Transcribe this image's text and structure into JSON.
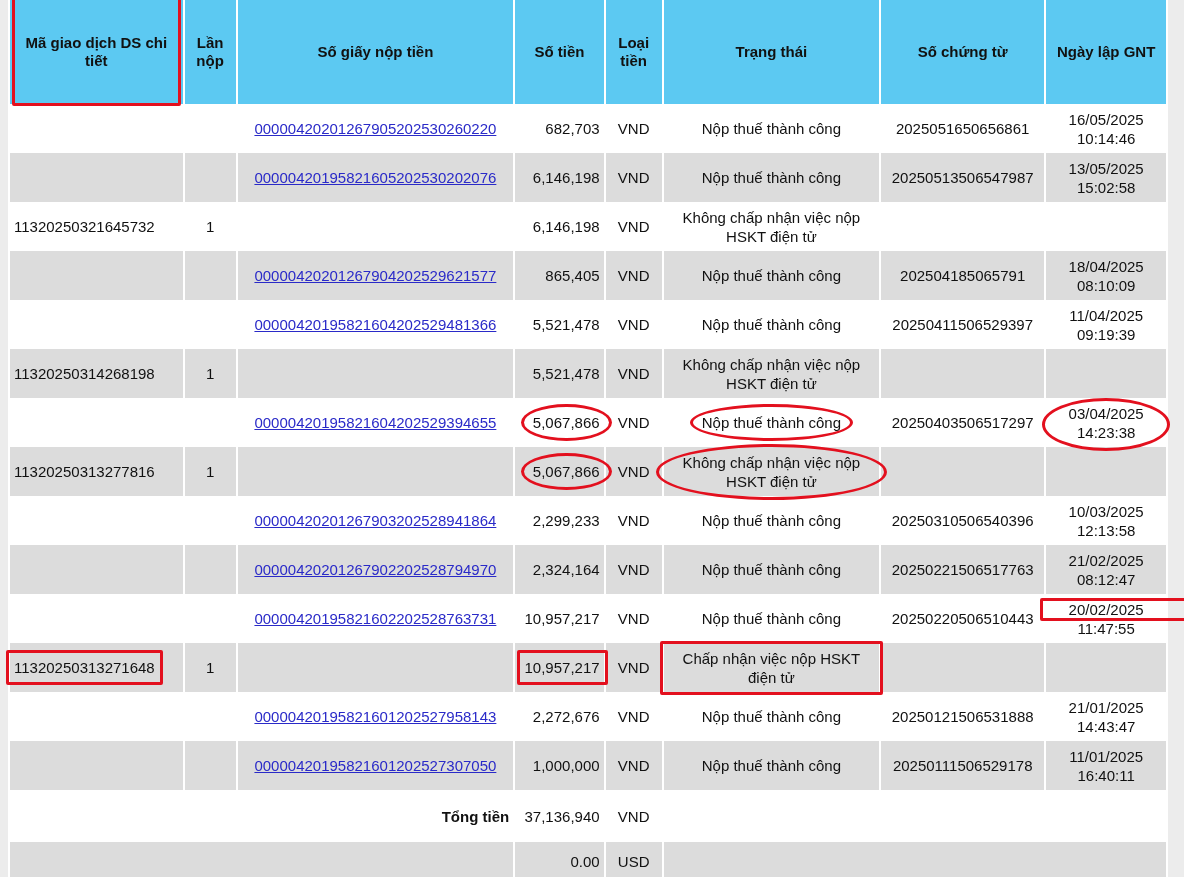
{
  "columns": [
    {
      "label": "Mã giao dịch DS chi tiết",
      "boxed": true
    },
    {
      "label": "Lần nộp"
    },
    {
      "label": "Số giấy nộp tiền"
    },
    {
      "label": "Số tiền"
    },
    {
      "label": "Loại tiền"
    },
    {
      "label": "Trạng thái"
    },
    {
      "label": "Số chứng từ"
    },
    {
      "label": "Ngày lập GNT"
    }
  ],
  "rows": [
    {
      "receipt": "00000420201267905202530260220",
      "amount": "682,703",
      "currency": "VND",
      "status": "Nộp thuế thành công",
      "voucher": "2025051650656861",
      "date": "16/05/2025",
      "time": "10:14:46"
    },
    {
      "receipt": "00000420195821605202530202076",
      "amount": "6,146,198",
      "currency": "VND",
      "status": "Nộp thuế thành công",
      "voucher": "20250513506547987",
      "date": "13/05/2025",
      "time": "15:02:58"
    },
    {
      "transaction_id": "11320250321645732",
      "attempt": "1",
      "amount": "6,146,198",
      "currency": "VND",
      "status": "Không chấp nhận việc nộp HSKT điện tử"
    },
    {
      "receipt": "00000420201267904202529621577",
      "amount": "865,405",
      "currency": "VND",
      "status": "Nộp thuế thành công",
      "voucher": "202504185065791",
      "date": "18/04/2025",
      "time": "08:10:09"
    },
    {
      "receipt": "00000420195821604202529481366",
      "amount": "5,521,478",
      "currency": "VND",
      "status": "Nộp thuế thành công",
      "voucher": "20250411506529397",
      "date": "11/04/2025",
      "time": "09:19:39"
    },
    {
      "transaction_id": "11320250314268198",
      "attempt": "1",
      "amount": "5,521,478",
      "currency": "VND",
      "status": "Không chấp nhận việc nộp HSKT điện tử"
    },
    {
      "receipt": "00000420195821604202529394655",
      "amount": "5,067,866",
      "currency": "VND",
      "status": "Nộp thuế thành công",
      "voucher": "20250403506517297",
      "date": "03/04/2025",
      "time": "14:23:38",
      "circled": {
        "amount": true,
        "status": true,
        "date": true
      }
    },
    {
      "transaction_id": "11320250313277816",
      "attempt": "1",
      "amount": "5,067,866",
      "currency": "VND",
      "status": "Không chấp nhận việc nộp HSKT điện tử",
      "circled": {
        "amount": true,
        "status": true
      }
    },
    {
      "receipt": "00000420201267903202528941864",
      "amount": "2,299,233",
      "currency": "VND",
      "status": "Nộp thuế thành công",
      "voucher": "20250310506540396",
      "date": "10/03/2025",
      "time": "12:13:58"
    },
    {
      "receipt": "00000420201267902202528794970",
      "amount": "2,324,164",
      "currency": "VND",
      "status": "Nộp thuế thành công",
      "voucher": "20250221506517763",
      "date": "21/02/2025",
      "time": "08:12:47"
    },
    {
      "receipt": "00000420195821602202528763731",
      "amount": "10,957,217",
      "currency": "VND",
      "status": "Nộp thuế thành công",
      "voucher": "20250220506510443",
      "date": "20/02/2025",
      "time": "11:47:55",
      "boxed": {
        "date": true
      }
    },
    {
      "transaction_id": "11320250313271648",
      "attempt": "1",
      "amount": "10,957,217",
      "currency": "VND",
      "status": "Chấp nhận việc nộp HSKT điện tử",
      "boxed": {
        "transaction_id": true,
        "amount": true,
        "status": true
      }
    },
    {
      "receipt": "00000420195821601202527958143",
      "amount": "2,272,676",
      "currency": "VND",
      "status": "Nộp thuế thành công",
      "voucher": "20250121506531888",
      "date": "21/01/2025",
      "time": "14:43:47"
    },
    {
      "receipt": "00000420195821601202527307050",
      "amount": "1,000,000",
      "currency": "VND",
      "status": "Nộp thuế thành công",
      "voucher": "20250111506529178",
      "date": "11/01/2025",
      "time": "16:40:11"
    }
  ],
  "totals": [
    {
      "label": "Tổng tiền",
      "amount": "37,136,940",
      "currency": "VND"
    },
    {
      "amount": "0.00",
      "currency": "USD"
    }
  ]
}
